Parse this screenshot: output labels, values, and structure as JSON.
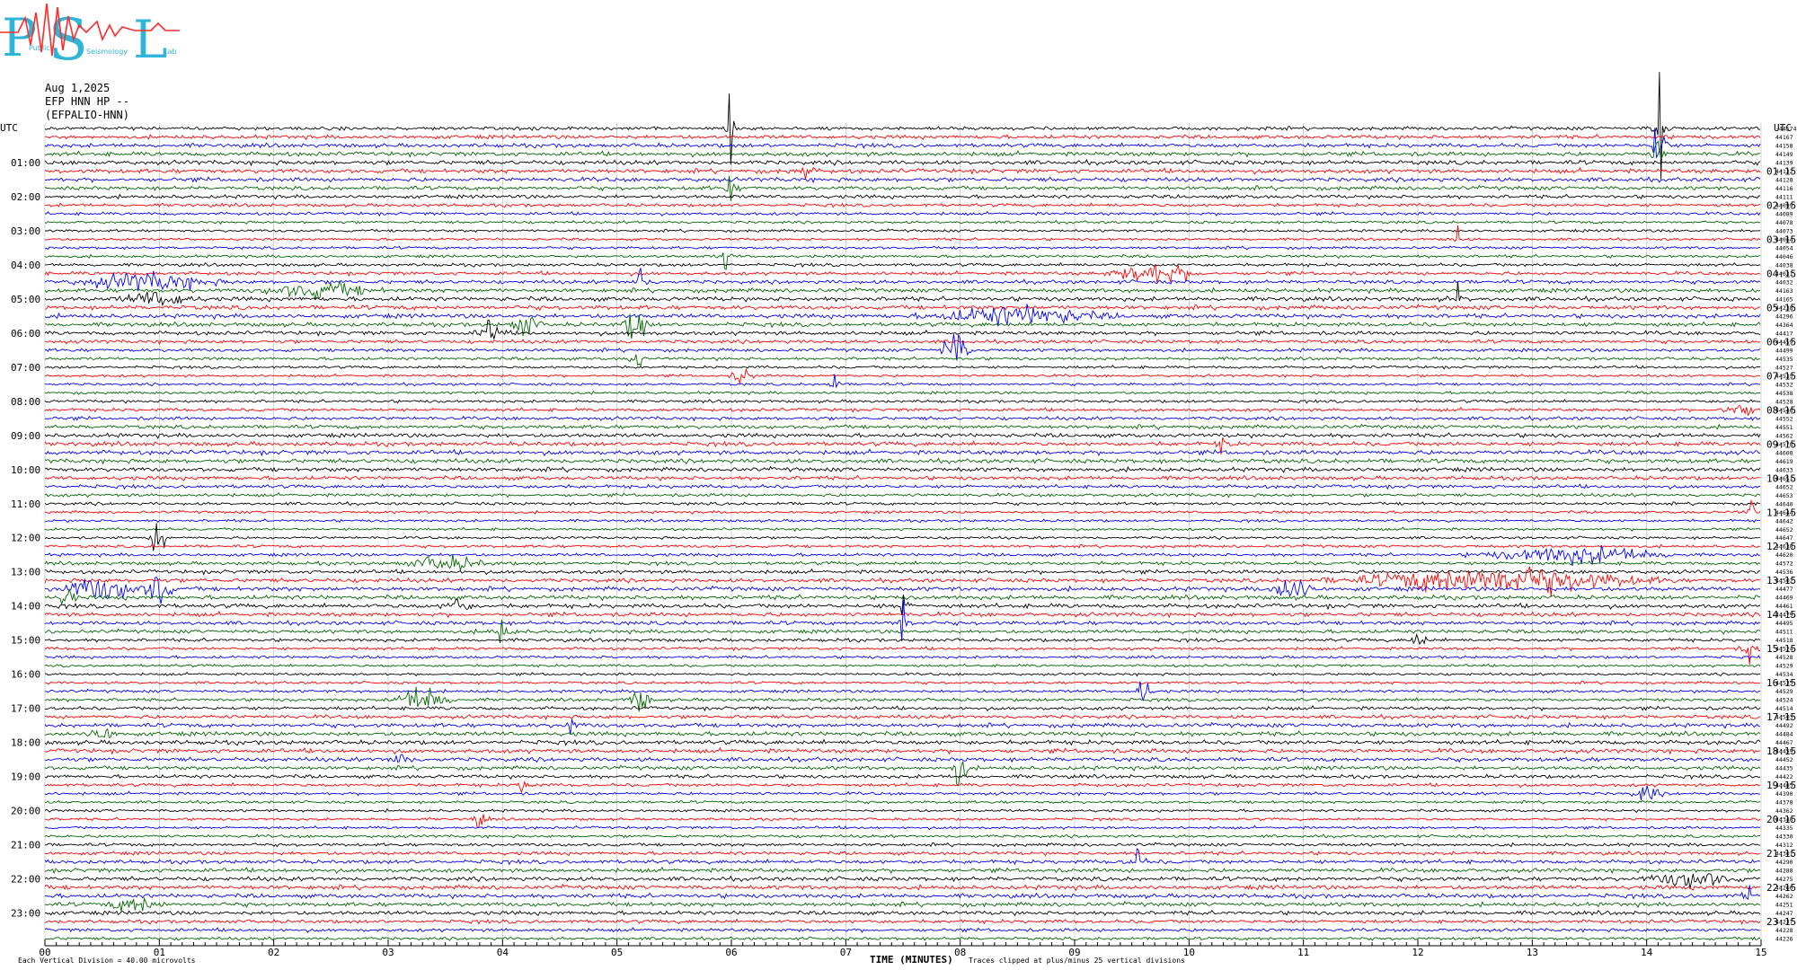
{
  "logo": {
    "letters": [
      "P",
      "S",
      "L"
    ],
    "small_text": [
      "Public",
      "Seismology",
      "Lab"
    ],
    "colors": {
      "letters": "#2fb5d6",
      "wave": "#ff2a2a"
    }
  },
  "header": {
    "date": "Aug 1,2025",
    "channel": "EFP HNN HP --",
    "station_code": "(EFPALIO-HNN)"
  },
  "axis": {
    "left_title": "UTC",
    "right_title": "UTC",
    "left_hour_labels": [
      "01:00",
      "02:00",
      "03:00",
      "04:00",
      "05:00",
      "06:00",
      "07:00",
      "08:00",
      "09:00",
      "10:00",
      "11:00",
      "12:00",
      "13:00",
      "14:00",
      "15:00",
      "16:00",
      "17:00",
      "18:00",
      "19:00",
      "20:00",
      "21:00",
      "22:00",
      "23:00"
    ],
    "right_hour_labels": [
      "01:15",
      "02:15",
      "03:15",
      "04:15",
      "05:15",
      "06:15",
      "07:15",
      "08:15",
      "09:15",
      "10:15",
      "11:15",
      "12:15",
      "13:15",
      "14:15",
      "15:15",
      "16:15",
      "17:15",
      "18:15",
      "19:15",
      "20:15",
      "21:15",
      "22:15",
      "23:15"
    ],
    "minute_ticks": [
      "00",
      "01",
      "02",
      "03",
      "04",
      "05",
      "06",
      "07",
      "08",
      "09",
      "10",
      "11",
      "12",
      "13",
      "14",
      "15"
    ],
    "x_title": "TIME (MINUTES)"
  },
  "footer": {
    "scale": "Each Vertical Division =   40.00 microvolts",
    "clip_note": "Traces clipped at plus/minus 25 vertical divisions"
  },
  "chart_data": {
    "type": "line",
    "title": "",
    "xlabel": "TIME (MINUTES)",
    "ylabel": "UTC",
    "xlim": [
      0,
      15
    ],
    "trace_count": 96,
    "trace_minutes": 15,
    "trace_color_cycle": [
      "#000000",
      "#ff0000",
      "#0000ff",
      "#006600"
    ],
    "right_counts": [
      "-44574",
      "44167",
      "44158",
      "44149",
      "44139",
      "44132",
      "44128",
      "44116",
      "44111",
      "44099",
      "44089",
      "44078",
      "44073",
      "44064",
      "44054",
      "44046",
      "44038",
      "44031",
      "44032",
      "44163",
      "44165",
      "44238",
      "44296",
      "44364",
      "44417",
      "44459",
      "44499",
      "44535",
      "44527",
      "44535",
      "44532",
      "44538",
      "44528",
      "44546",
      "44552",
      "44551",
      "44562",
      "44578",
      "44608",
      "44619",
      "44633",
      "44651",
      "44652",
      "44653",
      "44640",
      "44644",
      "44642",
      "44652",
      "44647",
      "44638",
      "44620",
      "44572",
      "44536",
      "44502",
      "44477",
      "44469",
      "44461",
      "44479",
      "44495",
      "44511",
      "44518",
      "44524",
      "44528",
      "44529",
      "44534",
      "44535",
      "44529",
      "44524",
      "44514",
      "44503",
      "44492",
      "44484",
      "44467",
      "44459",
      "44452",
      "44435",
      "44422",
      "44405",
      "44390",
      "44378",
      "44362",
      "44348",
      "44335",
      "44330",
      "44312",
      "44301",
      "44290",
      "44288",
      "44275",
      "44266",
      "44262",
      "44251",
      "44247",
      "44237",
      "44228",
      "44226"
    ],
    "events": [
      {
        "trace": 0,
        "minute": 5.99,
        "amplitude": 10,
        "width": 0.05
      },
      {
        "trace": 0,
        "minute": 14.12,
        "amplitude": 14,
        "width": 0.06
      },
      {
        "trace": 2,
        "minute": 14.1,
        "amplitude": 5,
        "width": 0.2
      },
      {
        "trace": 3,
        "minute": 14.1,
        "amplitude": 3,
        "width": 0.15
      },
      {
        "trace": 5,
        "minute": 6.65,
        "amplitude": 2,
        "width": 0.12
      },
      {
        "trace": 7,
        "minute": 5.99,
        "amplitude": 3,
        "width": 0.1
      },
      {
        "trace": 13,
        "minute": 12.35,
        "amplitude": 3,
        "width": 0.04
      },
      {
        "trace": 15,
        "minute": 5.95,
        "amplitude": 3,
        "width": 0.08
      },
      {
        "trace": 17,
        "minute": 9.7,
        "amplitude": 2.2,
        "width": 0.9
      },
      {
        "trace": 18,
        "minute": 0.9,
        "amplitude": 1.6,
        "width": 1.5
      },
      {
        "trace": 18,
        "minute": 5.2,
        "amplitude": 3,
        "width": 0.1
      },
      {
        "trace": 19,
        "minute": 2.4,
        "amplitude": 1.5,
        "width": 1.2
      },
      {
        "trace": 20,
        "minute": 12.35,
        "amplitude": 4,
        "width": 0.08
      },
      {
        "trace": 20,
        "minute": 1.0,
        "amplitude": 1.4,
        "width": 0.8
      },
      {
        "trace": 22,
        "minute": 8.5,
        "amplitude": 1.8,
        "width": 1.8
      },
      {
        "trace": 23,
        "minute": 5.17,
        "amplitude": 4,
        "width": 0.25
      },
      {
        "trace": 23,
        "minute": 4.2,
        "amplitude": 2.5,
        "width": 0.3
      },
      {
        "trace": 24,
        "minute": 3.9,
        "amplitude": 2.2,
        "width": 0.3
      },
      {
        "trace": 26,
        "minute": 7.95,
        "amplitude": 4,
        "width": 0.3
      },
      {
        "trace": 27,
        "minute": 5.17,
        "amplitude": 2.5,
        "width": 0.15
      },
      {
        "trace": 29,
        "minute": 6.1,
        "amplitude": 1.5,
        "width": 0.25
      },
      {
        "trace": 30,
        "minute": 6.9,
        "amplitude": 1.8,
        "width": 0.15
      },
      {
        "trace": 33,
        "minute": 14.8,
        "amplitude": 1.5,
        "width": 0.4
      },
      {
        "trace": 37,
        "minute": 10.3,
        "amplitude": 1.5,
        "width": 0.15
      },
      {
        "trace": 45,
        "minute": 14.92,
        "amplitude": 2.5,
        "width": 0.1
      },
      {
        "trace": 48,
        "minute": 1.0,
        "amplitude": 4,
        "width": 0.2
      },
      {
        "trace": 50,
        "minute": 13.4,
        "amplitude": 1.6,
        "width": 2
      },
      {
        "trace": 51,
        "minute": 3.5,
        "amplitude": 1.3,
        "width": 0.9
      },
      {
        "trace": 53,
        "minute": 12.7,
        "amplitude": 2.6,
        "width": 3.1
      },
      {
        "trace": 54,
        "minute": 1.0,
        "amplitude": 5,
        "width": 0.25
      },
      {
        "trace": 54,
        "minute": 0.5,
        "amplitude": 2.2,
        "width": 0.9
      },
      {
        "trace": 54,
        "minute": 10.9,
        "amplitude": 2.5,
        "width": 0.45
      },
      {
        "trace": 55,
        "minute": 0.2,
        "amplitude": 3,
        "width": 0.15
      },
      {
        "trace": 56,
        "minute": 3.6,
        "amplitude": 1.5,
        "width": 0.3
      },
      {
        "trace": 56,
        "minute": 7.5,
        "amplitude": 2.5,
        "width": 0.12
      },
      {
        "trace": 58,
        "minute": 7.5,
        "amplitude": 5,
        "width": 0.1
      },
      {
        "trace": 59,
        "minute": 3.99,
        "amplitude": 4,
        "width": 0.12
      },
      {
        "trace": 60,
        "minute": 12.0,
        "amplitude": 1.6,
        "width": 0.2
      },
      {
        "trace": 61,
        "minute": 14.9,
        "amplitude": 5,
        "width": 0.08
      },
      {
        "trace": 66,
        "minute": 9.6,
        "amplitude": 4,
        "width": 0.15
      },
      {
        "trace": 67,
        "minute": 3.3,
        "amplitude": 2.6,
        "width": 0.6
      },
      {
        "trace": 67,
        "minute": 5.2,
        "amplitude": 2.2,
        "width": 0.25
      },
      {
        "trace": 70,
        "minute": 4.6,
        "amplitude": 2,
        "width": 0.1
      },
      {
        "trace": 71,
        "minute": 0.5,
        "amplitude": 1.5,
        "width": 0.3
      },
      {
        "trace": 74,
        "minute": 3.1,
        "amplitude": 1.5,
        "width": 0.25
      },
      {
        "trace": 75,
        "minute": 8.0,
        "amplitude": 5,
        "width": 0.15
      },
      {
        "trace": 77,
        "minute": 4.2,
        "amplitude": 1.4,
        "width": 0.2
      },
      {
        "trace": 78,
        "minute": 14.0,
        "amplitude": 1.6,
        "width": 0.3
      },
      {
        "trace": 81,
        "minute": 3.8,
        "amplitude": 1.4,
        "width": 0.2
      },
      {
        "trace": 86,
        "minute": 9.55,
        "amplitude": 3,
        "width": 0.1
      },
      {
        "trace": 88,
        "minute": 14.4,
        "amplitude": 1.6,
        "width": 0.9
      },
      {
        "trace": 90,
        "minute": 14.9,
        "amplitude": 3,
        "width": 0.1
      },
      {
        "trace": 91,
        "minute": 0.8,
        "amplitude": 1.4,
        "width": 0.6
      }
    ]
  }
}
